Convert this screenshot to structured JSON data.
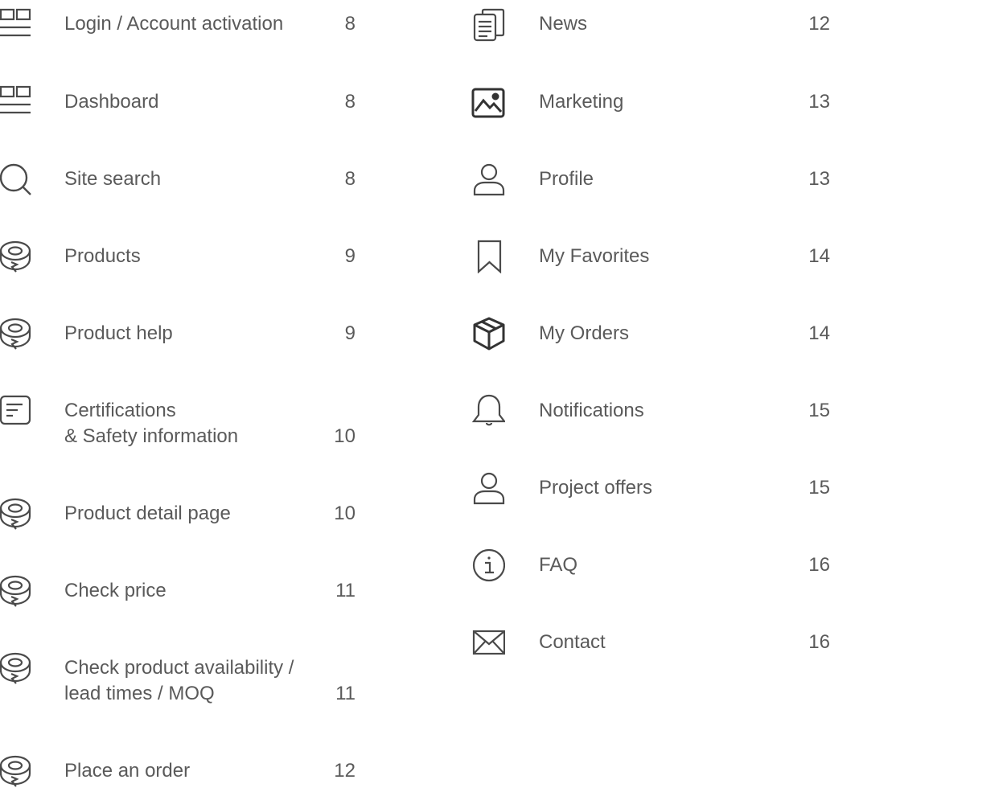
{
  "toc": {
    "left": [
      {
        "icon": "dashboard-icon",
        "label": "Login / Account activation",
        "page": "8"
      },
      {
        "icon": "dashboard-icon",
        "label": "Dashboard",
        "page": "8"
      },
      {
        "icon": "search-icon",
        "label": "Site search",
        "page": "8"
      },
      {
        "icon": "tape-roll-icon",
        "label": "Products",
        "page": "9"
      },
      {
        "icon": "tape-roll-icon",
        "label": "Product help",
        "page": "9"
      },
      {
        "icon": "document-icon",
        "label": "Certifications",
        "label2": "& Safety information",
        "page": "10"
      },
      {
        "icon": "tape-roll-icon",
        "label": "Product detail page",
        "page": "10"
      },
      {
        "icon": "tape-roll-icon",
        "label": "Check price",
        "page": "11"
      },
      {
        "icon": "tape-roll-icon",
        "label": "Check product availability /",
        "label2": "lead times / MOQ",
        "page": "11"
      },
      {
        "icon": "tape-roll-icon",
        "label": "Place an order",
        "page": "12"
      }
    ],
    "right": [
      {
        "icon": "news-icon",
        "label": "News",
        "page": "12"
      },
      {
        "icon": "image-icon",
        "label": "Marketing",
        "page": "13"
      },
      {
        "icon": "user-icon",
        "label": "Profile",
        "page": "13"
      },
      {
        "icon": "bookmark-icon",
        "label": "My Favorites",
        "page": "14"
      },
      {
        "icon": "package-icon",
        "label": "My Orders",
        "page": "14"
      },
      {
        "icon": "bell-icon",
        "label": "Notifications",
        "page": "15"
      },
      {
        "icon": "user-icon",
        "label": "Project offers",
        "page": "15"
      },
      {
        "icon": "info-icon",
        "label": "FAQ",
        "page": "16"
      },
      {
        "icon": "mail-icon",
        "label": "Contact",
        "page": "16"
      }
    ]
  },
  "colors": {
    "text": "#5a5a5a",
    "icon": "#4a4a4a"
  }
}
